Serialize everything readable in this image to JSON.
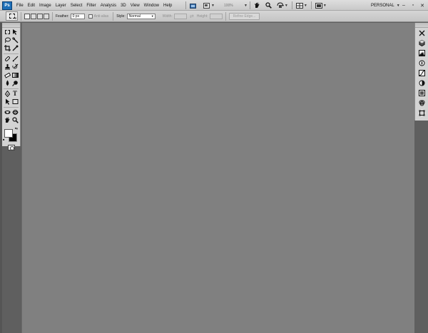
{
  "app": {
    "logo_text": "Ps",
    "workspace": "PERSONAL"
  },
  "menu": {
    "items": [
      "File",
      "Edit",
      "Image",
      "Layer",
      "Select",
      "Filter",
      "Analysis",
      "3D",
      "View",
      "Window",
      "Help"
    ]
  },
  "appbar": {
    "zoom_level": "100%"
  },
  "options": {
    "feather_label": "Feather:",
    "feather_value": "0 px",
    "antialias_label": "Anti-alias",
    "style_label": "Style:",
    "style_value": "Normal",
    "width_label": "Width:",
    "height_label": "Height:",
    "refine_edge_label": "Refine Edge..."
  },
  "colors": {
    "foreground": "#ffffff",
    "background": "#000000",
    "canvas": "#808080",
    "chrome": "#d3d3d3"
  }
}
